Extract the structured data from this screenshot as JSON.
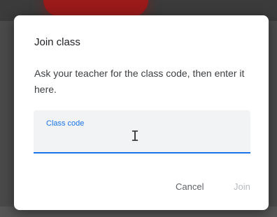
{
  "dialog": {
    "title": "Join class",
    "description": "Ask your teacher for the class code, then enter it here.",
    "field": {
      "label": "Class code",
      "value": "",
      "cursor_icon": "text-cursor-icon"
    },
    "buttons": {
      "cancel_label": "Cancel",
      "join_label": "Join"
    }
  },
  "colors": {
    "accent": "#1a73e8",
    "disabled_text": "#b8bcc0"
  }
}
